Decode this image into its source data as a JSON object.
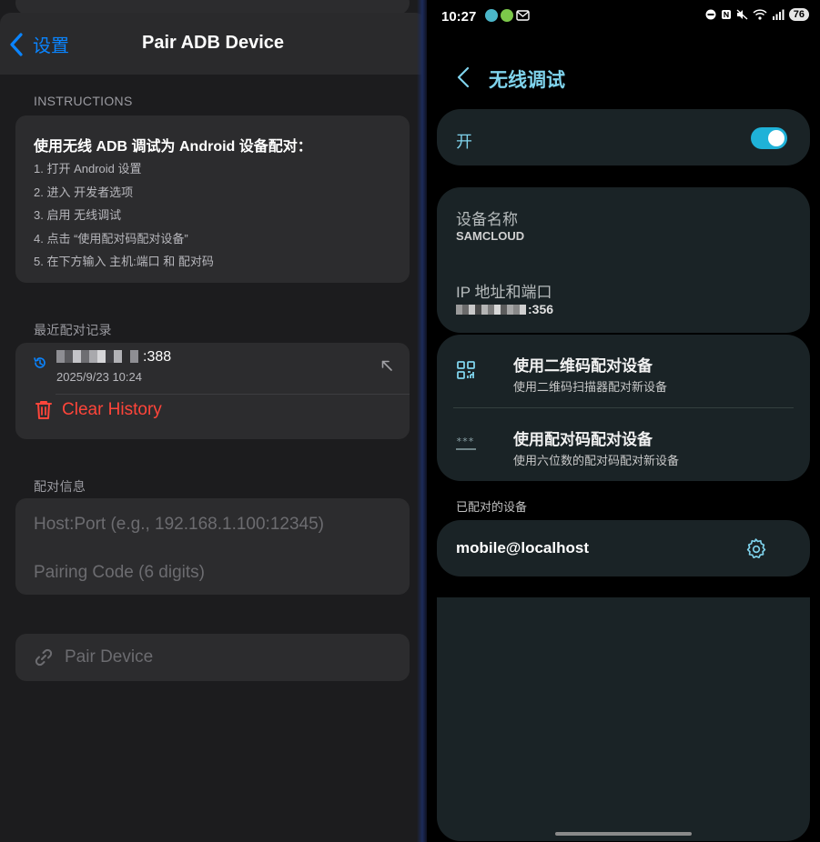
{
  "ios": {
    "nav": {
      "back_label": "设置",
      "title": "Pair ADB Device"
    },
    "instructions": {
      "section_label": "INSTRUCTIONS",
      "title": "使用无线 ADB 调试为 Android 设备配对：",
      "steps": [
        "1. 打开 Android 设置",
        "2. 进入 开发者选项",
        "3. 启用 无线调试",
        "4. 点击 “使用配对码配对设备”",
        "5. 在下方输入 主机:端口 和 配对码"
      ]
    },
    "history": {
      "section_label": "最近配对记录",
      "item": {
        "host_suffix": ":388",
        "date": "2025/9/23 10:24"
      },
      "clear_label": "Clear History"
    },
    "pairing": {
      "section_label": "配对信息",
      "host_placeholder": "Host:Port (e.g., 192.168.1.100:12345)",
      "code_placeholder": "Pairing Code (6 digits)"
    },
    "pair_button_label": "Pair Device"
  },
  "android": {
    "status": {
      "time": "10:27",
      "battery": "76"
    },
    "title": "无线调试",
    "toggle": {
      "label": "开",
      "on": true
    },
    "device_name": {
      "label": "设备名称",
      "value": "SAMCLOUD"
    },
    "ip_port": {
      "label": "IP 地址和端口",
      "value_suffix": ":356"
    },
    "options": [
      {
        "icon": "qr-code-icon",
        "title": "使用二维码配对设备",
        "subtitle": "使用二维码扫描器配对新设备"
      },
      {
        "icon": "password-dots-icon",
        "title": "使用配对码配对设备",
        "subtitle": "使用六位数的配对码配对新设备"
      }
    ],
    "paired_section_label": "已配对的设备",
    "paired_devices": [
      {
        "name": "mobile@localhost"
      }
    ]
  },
  "colors": {
    "ios_accent": "#0a84ff",
    "ios_destructive": "#ff453a",
    "android_accent": "#7fd3ec",
    "android_toggle": "#1fb2d8",
    "android_card": "#1a2326"
  }
}
